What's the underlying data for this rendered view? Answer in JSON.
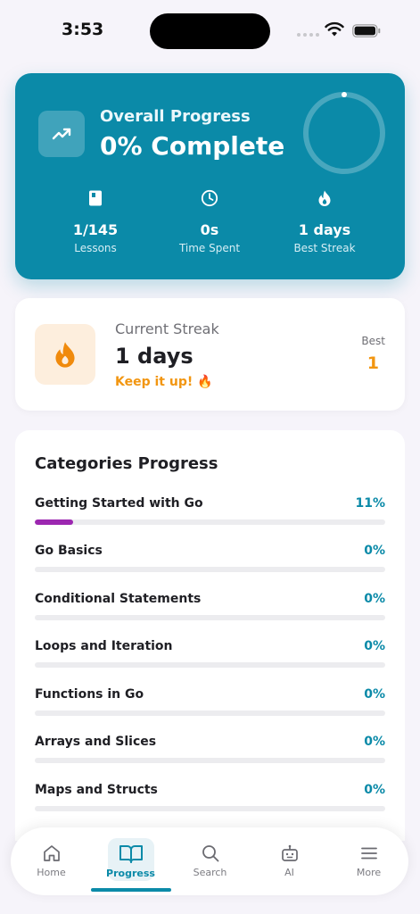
{
  "status_bar": {
    "time": "3:53"
  },
  "colors": {
    "accent": "#0b8aa8",
    "streak": "#f29611",
    "bar_fill": "#9c27b0"
  },
  "overall": {
    "label": "Overall Progress",
    "title": "0% Complete",
    "percent": 0,
    "stats": [
      {
        "icon": "book-icon",
        "value": "1/145",
        "label": "Lessons"
      },
      {
        "icon": "clock-icon",
        "value": "0s",
        "label": "Time Spent"
      },
      {
        "icon": "flame-icon",
        "value": "1 days",
        "label": "Best Streak"
      }
    ]
  },
  "streak": {
    "label": "Current Streak",
    "value": "1 days",
    "message": "Keep it up! 🔥",
    "best_label": "Best",
    "best_value": "1"
  },
  "categories": {
    "title": "Categories Progress",
    "items": [
      {
        "name": "Getting Started with Go",
        "percent_label": "11%",
        "progress": 0.11
      },
      {
        "name": "Go Basics",
        "percent_label": "0%",
        "progress": 0
      },
      {
        "name": "Conditional Statements",
        "percent_label": "0%",
        "progress": 0
      },
      {
        "name": "Loops and Iteration",
        "percent_label": "0%",
        "progress": 0
      },
      {
        "name": "Functions in Go",
        "percent_label": "0%",
        "progress": 0
      },
      {
        "name": "Arrays and Slices",
        "percent_label": "0%",
        "progress": 0
      },
      {
        "name": "Maps and Structs",
        "percent_label": "0%",
        "progress": 0
      }
    ]
  },
  "nav": {
    "active": "Progress",
    "items": [
      {
        "icon": "home-icon",
        "label": "Home"
      },
      {
        "icon": "book-open-icon",
        "label": "Progress"
      },
      {
        "icon": "search-icon",
        "label": "Search"
      },
      {
        "icon": "robot-icon",
        "label": "AI"
      },
      {
        "icon": "menu-icon",
        "label": "More"
      }
    ]
  }
}
